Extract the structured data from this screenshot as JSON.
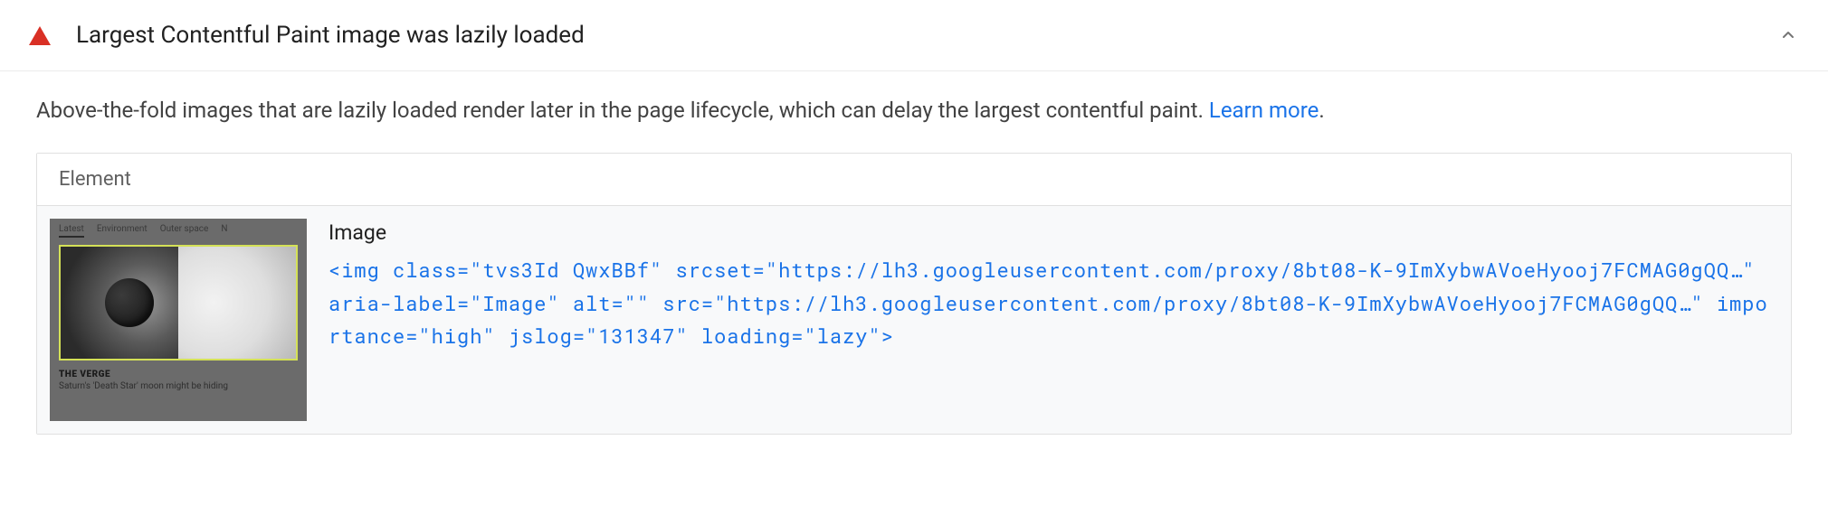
{
  "audit": {
    "title": "Largest Contentful Paint image was lazily loaded",
    "description": "Above-the-fold images that are lazily loaded render later in the page lifecycle, which can delay the largest contentful paint. ",
    "learn_more": "Learn more",
    "table": {
      "header": "Element",
      "row": {
        "label": "Image",
        "code": "<img class=\"tvs3Id QwxBBf\" srcset=\"https://lh3.googleusercontent.com/proxy/8bt08-K-9ImXybwAVoeHyooj7FCMAG0gQQ…\" aria-label=\"Image\" alt=\"\" src=\"https://lh3.googleusercontent.com/proxy/8bt08-K-9ImXybwAVoeHyooj7FCMAG0gQQ…\" importance=\"high\" jslog=\"131347\" loading=\"lazy\">"
      }
    }
  },
  "thumbnail": {
    "nav": [
      "Latest",
      "Environment",
      "Outer space",
      "N"
    ],
    "brand": "THE VERGE",
    "caption": "Saturn's 'Death Star' moon might be hiding"
  }
}
